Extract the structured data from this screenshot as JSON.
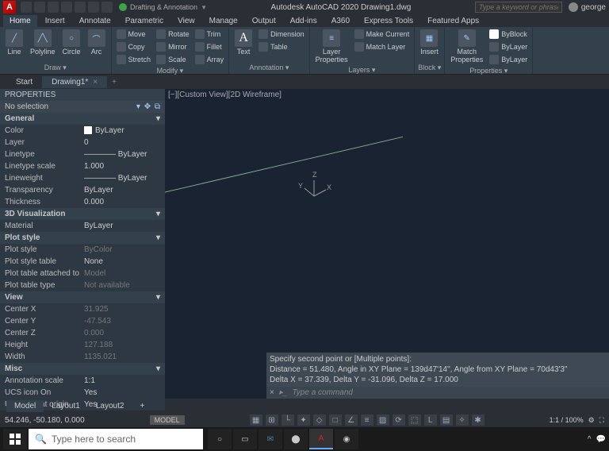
{
  "titlebar": {
    "workspace": "Drafting & Annotation",
    "title": "Autodesk AutoCAD 2020   Drawing1.dwg",
    "search_placeholder": "Type a keyword or phrase",
    "user": "george"
  },
  "ribbon_tabs": [
    "Home",
    "Insert",
    "Annotate",
    "Parametric",
    "View",
    "Manage",
    "Output",
    "Add-ins",
    "A360",
    "Express Tools",
    "Featured Apps"
  ],
  "ribbon": {
    "draw": {
      "label": "Draw ▾",
      "line": "Line",
      "polyline": "Polyline",
      "circle": "Circle",
      "arc": "Arc"
    },
    "modify": {
      "label": "Modify ▾",
      "move": "Move",
      "copy": "Copy",
      "stretch": "Stretch",
      "rotate": "Rotate",
      "mirror": "Mirror",
      "scale": "Scale",
      "trim": "Trim",
      "fillet": "Fillet",
      "array": "Array"
    },
    "annotation": {
      "label": "Annotation ▾",
      "text": "Text",
      "dimension": "Dimension",
      "table": "Table"
    },
    "layers": {
      "label": "Layers ▾",
      "props": "Layer\nProperties",
      "makecur": "Make Current",
      "matchlay": "Match Layer"
    },
    "block": {
      "label": "Block ▾",
      "insert": "Insert"
    },
    "properties": {
      "label": "Properties ▾",
      "match": "Match\nProperties",
      "byblock": "ByBlock",
      "bylayer1": "ByLayer",
      "bylayer2": "ByLayer"
    }
  },
  "filetabs": {
    "start": "Start",
    "drawing": "Drawing1*"
  },
  "properties_panel": {
    "title": "PROPERTIES",
    "selection": "No selection",
    "sections": [
      {
        "name": "General",
        "rows": [
          {
            "k": "Color",
            "v": "ByLayer",
            "swatch": true
          },
          {
            "k": "Layer",
            "v": "0"
          },
          {
            "k": "Linetype",
            "v": "———— ByLayer"
          },
          {
            "k": "Linetype scale",
            "v": "1.000"
          },
          {
            "k": "Lineweight",
            "v": "———— ByLayer"
          },
          {
            "k": "Transparency",
            "v": "ByLayer"
          },
          {
            "k": "Thickness",
            "v": "0.000"
          }
        ]
      },
      {
        "name": "3D Visualization",
        "rows": [
          {
            "k": "Material",
            "v": "ByLayer"
          }
        ]
      },
      {
        "name": "Plot style",
        "rows": [
          {
            "k": "Plot style",
            "v": "ByColor",
            "dim": true
          },
          {
            "k": "Plot style table",
            "v": "None"
          },
          {
            "k": "Plot table attached to",
            "v": "Model",
            "dim": true
          },
          {
            "k": "Plot table type",
            "v": "Not available",
            "dim": true
          }
        ]
      },
      {
        "name": "View",
        "rows": [
          {
            "k": "Center X",
            "v": "31.925",
            "dim": true
          },
          {
            "k": "Center Y",
            "v": "-47.543",
            "dim": true
          },
          {
            "k": "Center Z",
            "v": "0.000",
            "dim": true
          },
          {
            "k": "Height",
            "v": "127.188",
            "dim": true
          },
          {
            "k": "Width",
            "v": "1135.021",
            "dim": true
          }
        ]
      },
      {
        "name": "Misc",
        "rows": [
          {
            "k": "Annotation scale",
            "v": "1:1"
          },
          {
            "k": "UCS icon On",
            "v": "Yes"
          },
          {
            "k": "UCS icon at origin",
            "v": "Yes"
          }
        ]
      }
    ]
  },
  "canvas": {
    "viewlabel": "[−][Custom View][2D Wireframe]",
    "axes": {
      "x": "X",
      "y": "Y",
      "z": "Z"
    }
  },
  "command": {
    "hist1": "Specify second point or [Multiple points]:",
    "hist2": "Distance = 51.480,  Angle in XY Plane = 139d47'14\",  Angle from XY Plane = 70d43'3\"",
    "hist3": "Delta X = 37.339,  Delta Y = -31.096,  Delta Z = 17.000",
    "prompt": "Type a command"
  },
  "layouts": [
    "Model",
    "Layout1",
    "Layout2"
  ],
  "statusbar": {
    "coords": "54.246, -50.180, 0.000",
    "model": "MODEL",
    "scale": "1:1 / 100%"
  },
  "taskbar": {
    "search": "Type here to search"
  }
}
